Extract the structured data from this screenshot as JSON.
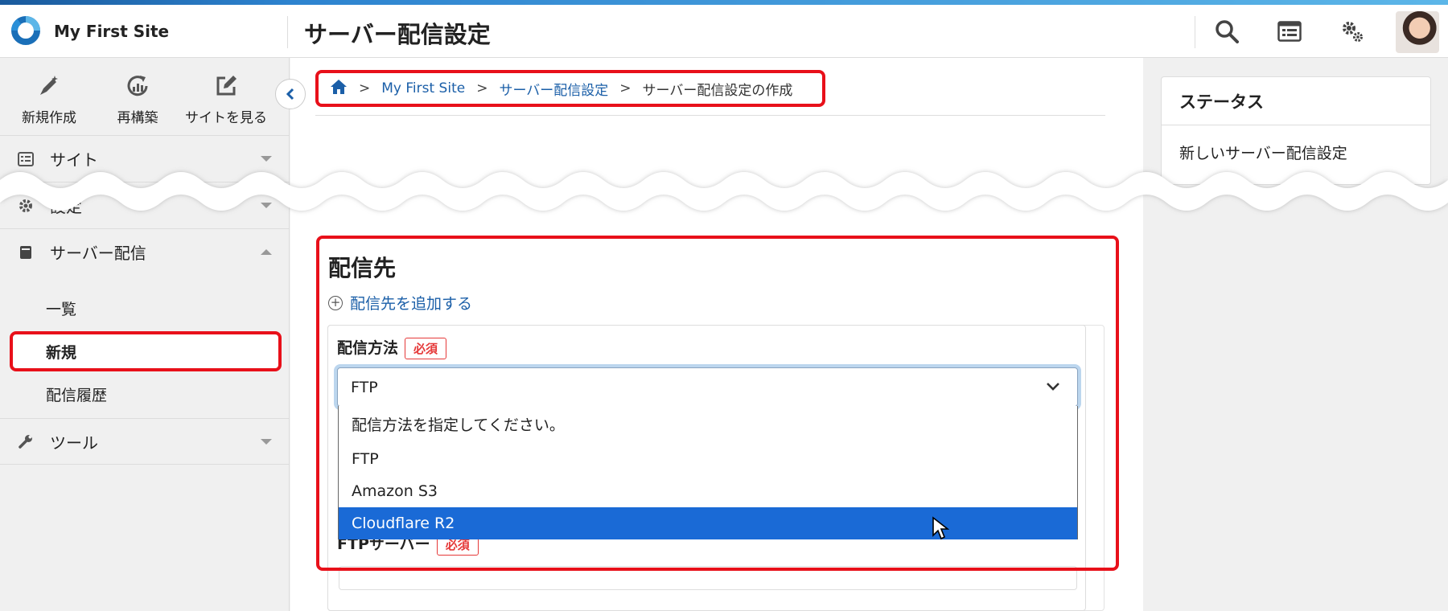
{
  "header": {
    "site_name": "My First Site",
    "page_title": "サーバー配信設定",
    "icons": [
      "search-icon",
      "list-icon",
      "gears-icon"
    ]
  },
  "sidebar": {
    "quick_actions": [
      {
        "label": "新規作成",
        "icon": "pencil-icon"
      },
      {
        "label": "再構築",
        "icon": "rebuild-icon"
      },
      {
        "label": "サイトを見る",
        "icon": "external-link-icon"
      }
    ],
    "nav": [
      {
        "label": "サイト",
        "icon": "site-icon"
      },
      {
        "label": "設定",
        "icon": "gear-icon"
      },
      {
        "label": "サーバー配信",
        "icon": "server-icon"
      },
      {
        "label": "ツール",
        "icon": "wrench-icon"
      }
    ],
    "sub_items": [
      "一覧",
      "新規",
      "配信履歴"
    ]
  },
  "breadcrumb": {
    "items": [
      "My First Site",
      "サーバー配信設定",
      "サーバー配信設定の作成"
    ],
    "separator": ">"
  },
  "status": {
    "title": "ステータス",
    "value": "新しいサーバー配信設定"
  },
  "destination": {
    "title": "配信先",
    "add_label": "配信先を追加する",
    "method_label": "配信方法",
    "required_badge": "必須",
    "selected_value": "FTP",
    "options": [
      "配信方法を指定してください。",
      "FTP",
      "Amazon S3",
      "Cloudflare R2"
    ],
    "ftp_server_label": "FTPサーバー"
  },
  "colors": {
    "accent_red": "#e8101a",
    "link_blue": "#1b5fa8",
    "selected_blue": "#1a6ad6"
  }
}
